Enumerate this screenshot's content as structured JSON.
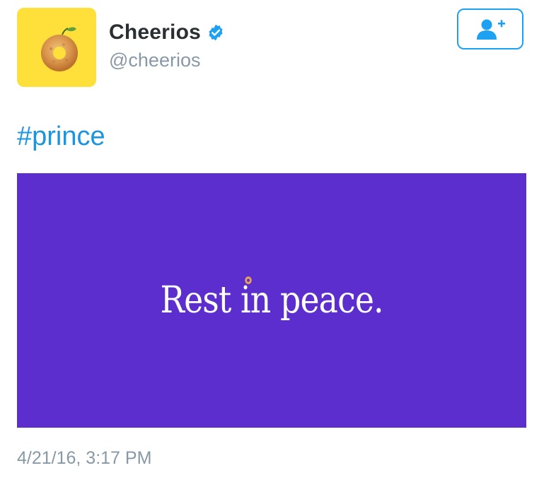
{
  "tweet": {
    "author": {
      "display_name": "Cheerios",
      "handle": "@cheerios",
      "verified": true,
      "avatar_icon": "cheerio-avatar-icon"
    },
    "follow_button": {
      "icon": "follow-user-plus-icon"
    },
    "text": "#prince",
    "media": {
      "text": "Rest in peace.",
      "background_color": "#5c2ece"
    },
    "timestamp": "4/21/16, 3:17 PM"
  },
  "colors": {
    "link_blue": "#1b95e0",
    "accent_blue": "#1da1f2",
    "name_text": "#292f33",
    "muted_text": "#8899a6",
    "avatar_yellow": "#ffdf3a"
  }
}
